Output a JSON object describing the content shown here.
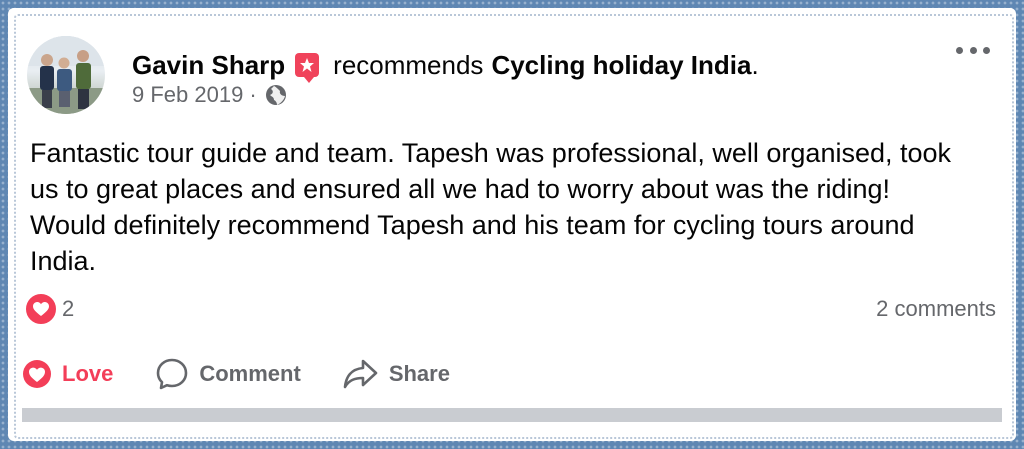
{
  "post": {
    "author": "Gavin Sharp",
    "verb": "recommends",
    "page_name": "Cycling holiday India",
    "punct": ".",
    "date": "9 Feb 2019",
    "date_separator": "·",
    "privacy_icon": "globe-icon",
    "body": "Fantastic tour guide and team. Tapesh was professional, well organised, took us to great places and ensured all we had to worry about was the riding!  Would definitely recommend Tapesh and his team for cycling tours around India."
  },
  "stats": {
    "reaction_icon": "love-reaction-icon",
    "reaction_count": "2",
    "comments": "2 comments"
  },
  "actions": {
    "love_label": "Love",
    "comment_label": "Comment",
    "share_label": "Share"
  },
  "colors": {
    "frame": "#5f87b3",
    "love": "#f33e58",
    "recommend_badge": "#f0435b",
    "secondary_text": "#65676b"
  }
}
